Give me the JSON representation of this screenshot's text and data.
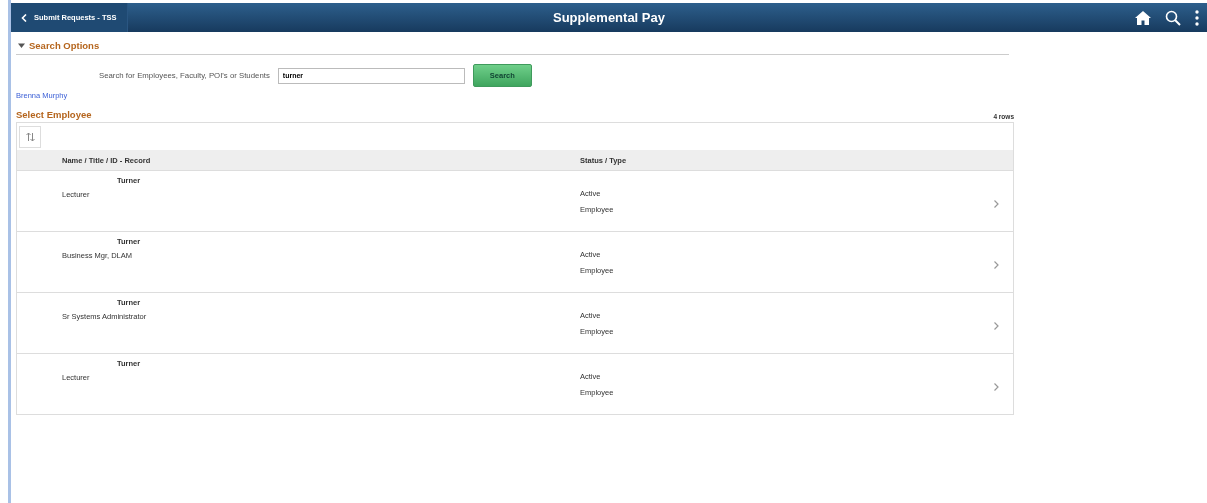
{
  "header": {
    "back_button": "Submit Requests - TSS",
    "title": "Supplemental Pay"
  },
  "search_options": {
    "heading": "Search Options",
    "expanded": true,
    "label": "Search for Employees, Faculty, POI's or Students",
    "value": "turner",
    "button": "Search"
  },
  "user_link": "Brenna Murphy",
  "grid": {
    "title": "Select Employee",
    "row_count": "4 rows",
    "columns": [
      "Name / Title / ID - Record",
      "Status / Type"
    ],
    "rows": [
      {
        "name": "Turner",
        "title": "Lecturer",
        "status": "Active",
        "type": "Employee"
      },
      {
        "name": "Turner",
        "title": "Business Mgr, DLAM",
        "status": "Active",
        "type": "Employee"
      },
      {
        "name": "Turner",
        "title": "Sr Systems Administrator",
        "status": "Active",
        "type": "Employee"
      },
      {
        "name": "Turner",
        "title": "Lecturer",
        "status": "Active",
        "type": "Employee"
      }
    ]
  }
}
